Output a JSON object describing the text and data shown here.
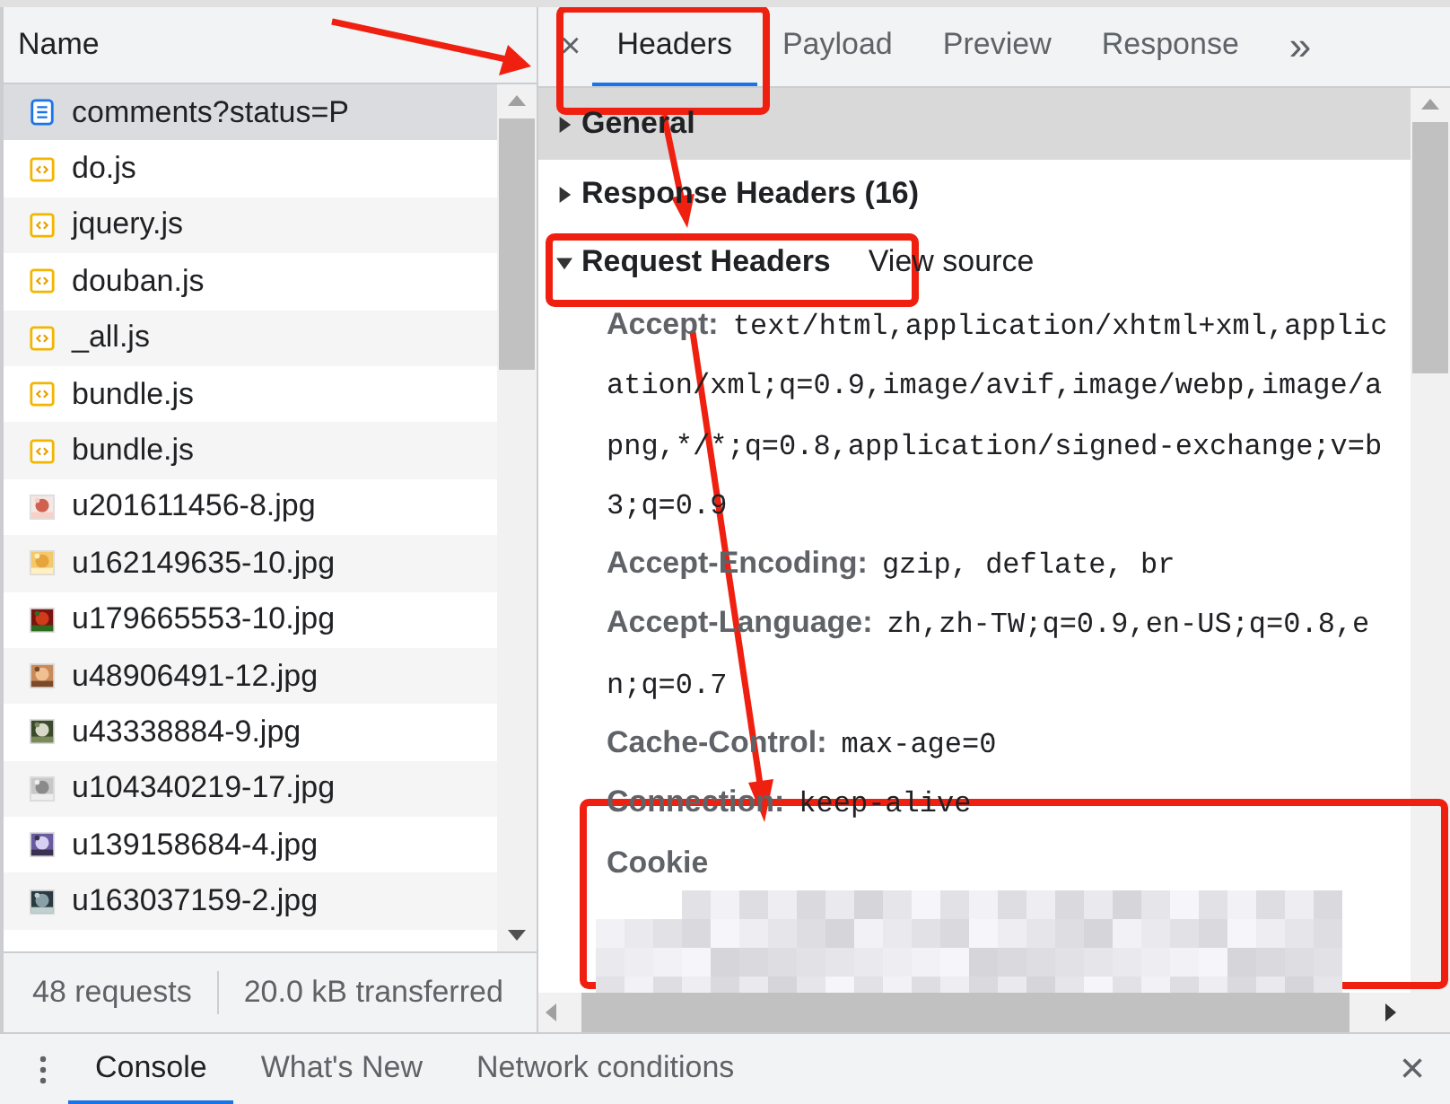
{
  "request_list": {
    "column": "Name",
    "rows": [
      {
        "name": "comments?status=P",
        "kind": "document",
        "selected": true
      },
      {
        "name": "do.js",
        "kind": "script",
        "selected": false
      },
      {
        "name": "jquery.js",
        "kind": "script",
        "selected": false
      },
      {
        "name": "douban.js",
        "kind": "script",
        "selected": false
      },
      {
        "name": "_all.js",
        "kind": "script",
        "selected": false
      },
      {
        "name": "bundle.js",
        "kind": "script",
        "selected": false
      },
      {
        "name": "bundle.js",
        "kind": "script",
        "selected": false
      },
      {
        "name": "u201611456-8.jpg",
        "selected": false
      },
      {
        "name": "u162149635-10.jpg",
        "selected": false
      },
      {
        "name": "u179665553-10.jpg",
        "selected": false
      },
      {
        "name": "u48906491-12.jpg",
        "selected": false
      },
      {
        "name": "u43338884-9.jpg",
        "selected": false
      },
      {
        "name": "u104340219-17.jpg",
        "selected": false
      },
      {
        "name": "u139158684-4.jpg",
        "selected": false
      },
      {
        "name": "u163037159-2.jpg",
        "selected": false
      }
    ],
    "status": [
      "48 requests",
      "20.0 kB transferred"
    ]
  },
  "details": {
    "close": "×",
    "tabs": [
      {
        "label": "Headers",
        "selected": true
      },
      {
        "label": "Payload",
        "selected": false
      },
      {
        "label": "Preview",
        "selected": false
      },
      {
        "label": "Response",
        "selected": false
      }
    ],
    "more": "»",
    "sections": [
      {
        "title": "General",
        "expanded": false,
        "highlighted": true
      },
      {
        "title": "Response Headers (16)",
        "expanded": false,
        "highlighted": false
      },
      {
        "title": "Request Headers",
        "expanded": true,
        "highlighted": false,
        "link": "View source",
        "headers": [
          {
            "name": "Accept:",
            "value": "text/html,application/xhtml+xml,application/xml;q=0.9,image/avif,image/webp,image/apng,*/*;q=0.8,application/signed-exchange;v=b3;q=0.9"
          },
          {
            "name": "Accept-Encoding:",
            "value": "gzip, deflate, br"
          },
          {
            "name": "Accept-Language:",
            "value": "zh,zh-TW;q=0.9,en-US;q=0.8,en;q=0.7"
          },
          {
            "name": "Cache-Control:",
            "value": "max-age=0"
          },
          {
            "name": "Connection:",
            "value": "keep-alive"
          },
          {
            "name": "Cookie",
            "redacted": true
          }
        ]
      }
    ]
  },
  "drawer": {
    "tabs": [
      {
        "label": "Console",
        "selected": true
      },
      {
        "label": "What's New",
        "selected": false
      },
      {
        "label": "Network conditions",
        "selected": false
      }
    ],
    "close": "×"
  }
}
